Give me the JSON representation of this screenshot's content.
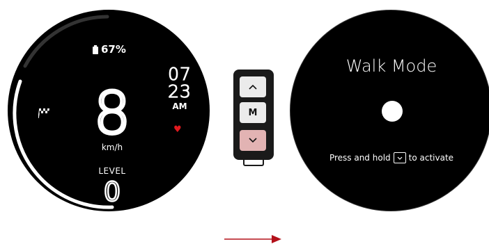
{
  "left_dial": {
    "battery_percent": "67%",
    "time_hour": "07",
    "time_minute": "23",
    "time_ampm": "AM",
    "speed": "8",
    "speed_unit": "km/h",
    "level_label": "LEVEL",
    "level_value": "0",
    "icons": {
      "battery": "battery-icon",
      "flag": "checkered-flag-icon",
      "heart": "heart-icon"
    }
  },
  "remote": {
    "up_icon": "chevron-up-icon",
    "mode_label": "M",
    "down_icon": "chevron-down-icon"
  },
  "right_dial": {
    "title": "Walk Mode",
    "instruction_prefix": "Press and hold",
    "instruction_suffix": "to activate",
    "key_icon": "chevron-down-icon"
  },
  "colors": {
    "background": "#000000",
    "text": "#ffffff",
    "heart": "#e0191e",
    "down_button": "#e2b3b3",
    "button": "#ebebeb",
    "arrow": "#b3111a",
    "arc": "#ffffff",
    "arc_track": "#333333"
  }
}
